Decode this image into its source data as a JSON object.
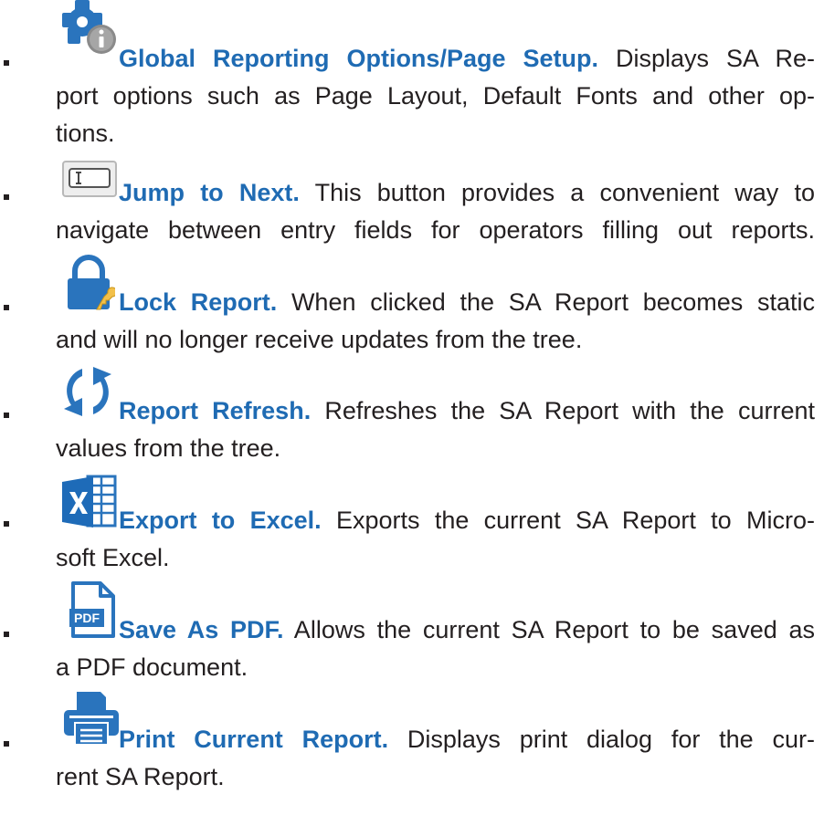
{
  "items": [
    {
      "icon": "gear-info-icon",
      "title": "Global Reporting Options/Page Setup.",
      "line1_rest": " Displays SA Re-",
      "line2": "port options such as Page Layout, Default Fonts and other op-",
      "line3": "tions."
    },
    {
      "icon": "text-field-icon",
      "title": "Jump to Next.",
      "line1_rest": " This button provides a convenient way to",
      "line2": "navigate between entry fields for operators filling out reports."
    },
    {
      "icon": "padlock-icon",
      "title": "Lock Report.",
      "line1_rest": " When clicked the SA Report becomes static",
      "line2": "and will no longer receive updates from the tree."
    },
    {
      "icon": "refresh-icon",
      "title": "Report Refresh.",
      "line1_rest": " Refreshes the SA Report with the current",
      "line2": "values from the tree."
    },
    {
      "icon": "excel-icon",
      "title": "Export to Excel.",
      "line1_rest": " Exports the current SA Report to Micro-",
      "line2": "soft Excel."
    },
    {
      "icon": "pdf-file-icon",
      "title": "Save As PDF.",
      "line1_rest": " Allows the current SA Report to be saved as",
      "line2": "a PDF document."
    },
    {
      "icon": "printer-icon",
      "title": "Print Current Report.",
      "line1_rest": " Displays print dialog for the cur-",
      "line2": "rent SA Report."
    }
  ],
  "colors": {
    "title": "#1f6bb3",
    "icon_blue": "#1e6bb8",
    "text": "#231f20"
  }
}
